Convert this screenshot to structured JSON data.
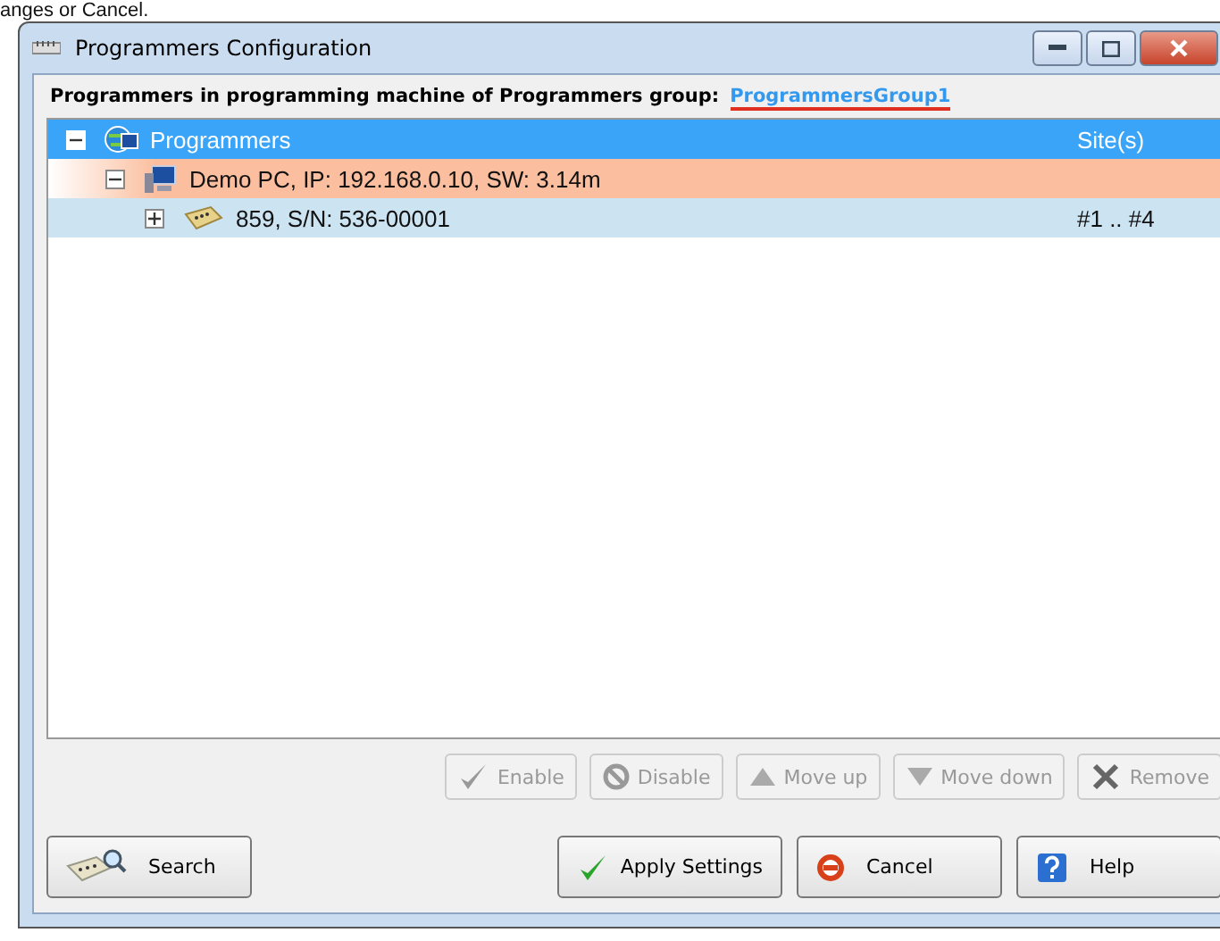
{
  "page_text": "anges or Cancel.",
  "window": {
    "title": "Programmers Configuration"
  },
  "header": {
    "label": "Programmers in programming machine of Programmers group:",
    "group_link": "ProgrammersGroup1"
  },
  "tree": {
    "columns": [
      "Site(s)"
    ],
    "nodes": [
      {
        "kind": "network",
        "label": "Programmers",
        "expanded": true,
        "selected": true,
        "highlighted": false,
        "children": [
          {
            "kind": "computer",
            "label": "Demo PC, IP: 192.168.0.10, SW: 3.14m",
            "expanded": true,
            "selected": false,
            "highlighted": true,
            "children": [
              {
                "kind": "programmer",
                "label": "859, S/N: 536-00001",
                "sites": "#1 .. #4",
                "expanded": false,
                "selected": false,
                "highlighted": false
              }
            ]
          }
        ]
      }
    ]
  },
  "item_buttons": [
    {
      "kind": "enable",
      "label": "Enable",
      "disabled": true
    },
    {
      "kind": "disable",
      "label": "Disable",
      "disabled": true
    },
    {
      "kind": "up",
      "label": "Move up",
      "disabled": true
    },
    {
      "kind": "down",
      "label": "Move down",
      "disabled": true
    },
    {
      "kind": "remove",
      "label": "Remove",
      "disabled": true
    }
  ],
  "search_button": {
    "label": "Search"
  },
  "dialog_buttons": [
    {
      "kind": "apply",
      "label": "Apply Settings"
    },
    {
      "kind": "cancel",
      "label": "Cancel"
    },
    {
      "kind": "help",
      "label": "Help"
    }
  ]
}
